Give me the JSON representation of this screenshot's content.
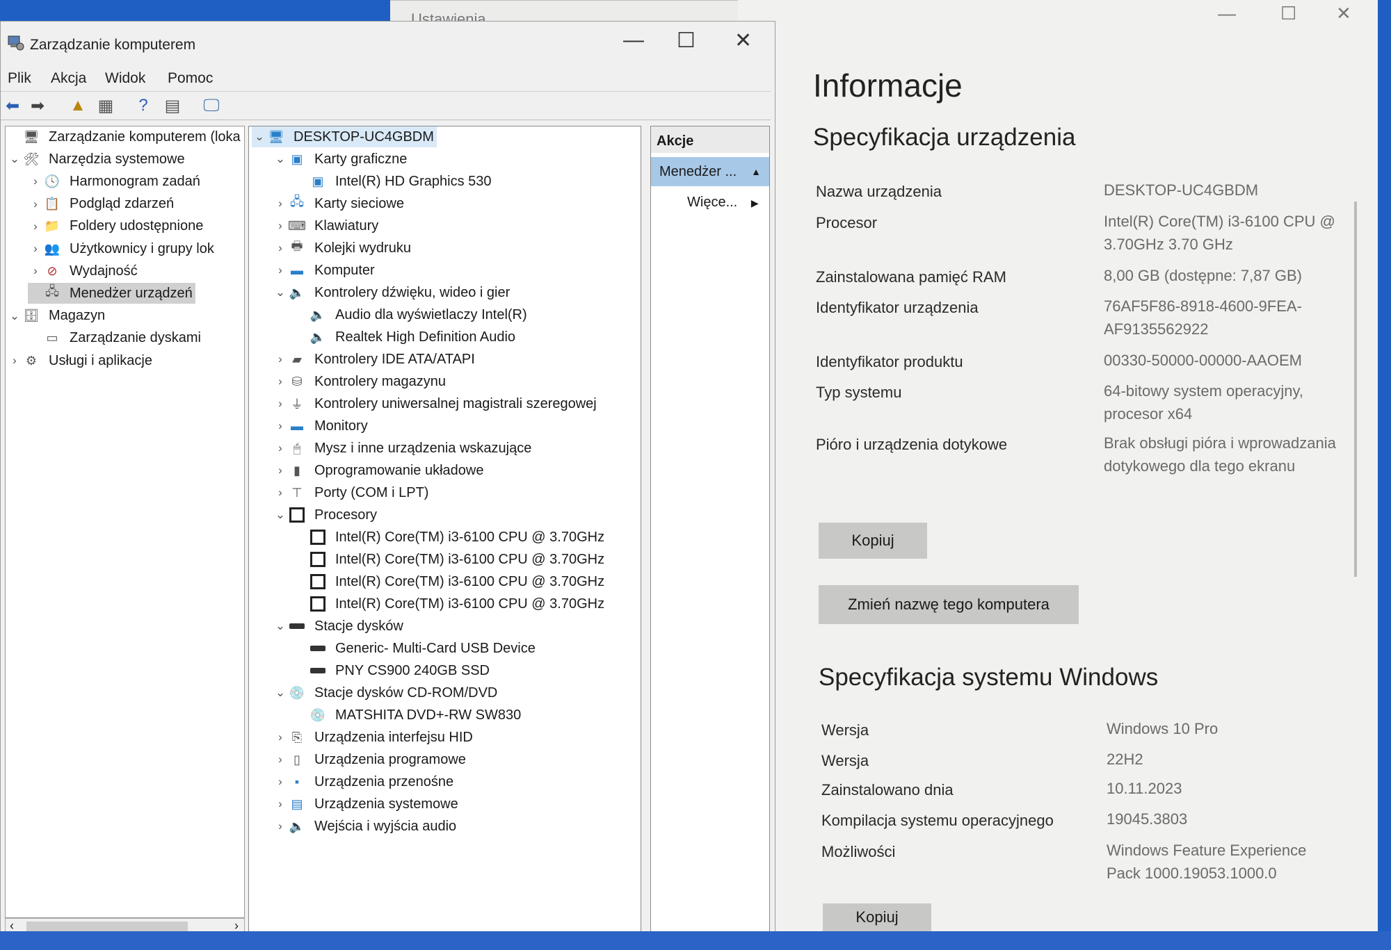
{
  "management": {
    "title": "Zarządzanie komputerem",
    "menu": [
      "Plik",
      "Akcja",
      "Widok",
      "Pomoc"
    ],
    "left_tree": [
      {
        "label": "Zarządzanie komputerem (loka",
        "level": 0,
        "chev": "",
        "icon": "computer-management-icon"
      },
      {
        "label": "Narzędzia systemowe",
        "level": 0,
        "chev": "v",
        "icon": "tools-icon"
      },
      {
        "label": "Harmonogram zadań",
        "level": 1,
        "chev": ">",
        "icon": "clock-icon"
      },
      {
        "label": "Podgląd zdarzeń",
        "level": 1,
        "chev": ">",
        "icon": "event-viewer-icon"
      },
      {
        "label": "Foldery udostępnione",
        "level": 1,
        "chev": ">",
        "icon": "shared-folder-icon"
      },
      {
        "label": "Użytkownicy i grupy lok",
        "level": 1,
        "chev": ">",
        "icon": "users-icon"
      },
      {
        "label": "Wydajność",
        "level": 1,
        "chev": ">",
        "icon": "performance-icon"
      },
      {
        "label": "Menedżer urządzeń",
        "level": 1,
        "chev": "",
        "icon": "device-manager-icon",
        "selected": true
      },
      {
        "label": "Magazyn",
        "level": 0,
        "chev": "v",
        "icon": "storage-icon"
      },
      {
        "label": "Zarządzanie dyskami",
        "level": 1,
        "chev": "",
        "icon": "disk-management-icon"
      },
      {
        "label": "Usługi i aplikacje",
        "level": 0,
        "chev": ">",
        "icon": "services-icon"
      }
    ],
    "device_tree": [
      {
        "label": "DESKTOP-UC4GBDM",
        "level": 0,
        "chev": "v",
        "icon": "desktop-icon",
        "selected": true
      },
      {
        "label": "Karty graficzne",
        "level": 1,
        "chev": "v",
        "icon": "display-adapter-icon"
      },
      {
        "label": "Intel(R) HD Graphics 530",
        "level": 2,
        "chev": "",
        "icon": "display-adapter-icon"
      },
      {
        "label": "Karty sieciowe",
        "level": 1,
        "chev": ">",
        "icon": "network-adapter-icon"
      },
      {
        "label": "Klawiatury",
        "level": 1,
        "chev": ">",
        "icon": "keyboard-icon"
      },
      {
        "label": "Kolejki wydruku",
        "level": 1,
        "chev": ">",
        "icon": "printer-icon"
      },
      {
        "label": "Komputer",
        "level": 1,
        "chev": ">",
        "icon": "monitor-icon"
      },
      {
        "label": "Kontrolery dźwięku, wideo i gier",
        "level": 1,
        "chev": "v",
        "icon": "speaker-icon"
      },
      {
        "label": "Audio dla wyświetlaczy Intel(R)",
        "level": 2,
        "chev": "",
        "icon": "speaker-icon"
      },
      {
        "label": "Realtek High Definition Audio",
        "level": 2,
        "chev": "",
        "icon": "speaker-icon"
      },
      {
        "label": "Kontrolery IDE ATA/ATAPI",
        "level": 1,
        "chev": ">",
        "icon": "ide-controller-icon"
      },
      {
        "label": "Kontrolery magazynu",
        "level": 1,
        "chev": ">",
        "icon": "storage-controller-icon"
      },
      {
        "label": "Kontrolery uniwersalnej magistrali szeregowej",
        "level": 1,
        "chev": ">",
        "icon": "usb-icon"
      },
      {
        "label": "Monitory",
        "level": 1,
        "chev": ">",
        "icon": "monitor-icon"
      },
      {
        "label": "Mysz i inne urządzenia wskazujące",
        "level": 1,
        "chev": ">",
        "icon": "mouse-icon"
      },
      {
        "label": "Oprogramowanie układowe",
        "level": 1,
        "chev": ">",
        "icon": "firmware-icon"
      },
      {
        "label": "Porty (COM i LPT)",
        "level": 1,
        "chev": ">",
        "icon": "port-icon"
      },
      {
        "label": "Procesory",
        "level": 1,
        "chev": "v",
        "icon": "cpu-icon"
      },
      {
        "label": "Intel(R) Core(TM) i3-6100 CPU @ 3.70GHz",
        "level": 2,
        "chev": "",
        "icon": "cpu-icon"
      },
      {
        "label": "Intel(R) Core(TM) i3-6100 CPU @ 3.70GHz",
        "level": 2,
        "chev": "",
        "icon": "cpu-icon"
      },
      {
        "label": "Intel(R) Core(TM) i3-6100 CPU @ 3.70GHz",
        "level": 2,
        "chev": "",
        "icon": "cpu-icon"
      },
      {
        "label": "Intel(R) Core(TM) i3-6100 CPU @ 3.70GHz",
        "level": 2,
        "chev": "",
        "icon": "cpu-icon"
      },
      {
        "label": "Stacje dysków",
        "level": 1,
        "chev": "v",
        "icon": "disk-drive-icon"
      },
      {
        "label": "Generic- Multi-Card USB Device",
        "level": 2,
        "chev": "",
        "icon": "disk-drive-icon"
      },
      {
        "label": "PNY CS900 240GB SSD",
        "level": 2,
        "chev": "",
        "icon": "disk-drive-icon"
      },
      {
        "label": "Stacje dysków CD-ROM/DVD",
        "level": 1,
        "chev": "v",
        "icon": "cdrom-icon"
      },
      {
        "label": "MATSHITA DVD+-RW SW830",
        "level": 2,
        "chev": "",
        "icon": "cdrom-icon"
      },
      {
        "label": "Urządzenia interfejsu HID",
        "level": 1,
        "chev": ">",
        "icon": "hid-icon"
      },
      {
        "label": "Urządzenia programowe",
        "level": 1,
        "chev": ">",
        "icon": "software-device-icon"
      },
      {
        "label": "Urządzenia przenośne",
        "level": 1,
        "chev": ">",
        "icon": "portable-device-icon"
      },
      {
        "label": "Urządzenia systemowe",
        "level": 1,
        "chev": ">",
        "icon": "system-device-icon"
      },
      {
        "label": "Wejścia i wyjścia audio",
        "level": 1,
        "chev": ">",
        "icon": "speaker-icon"
      }
    ],
    "actions": {
      "title": "Akcje",
      "selected": "Menedżer ...",
      "more": "Więce..."
    }
  },
  "settings": {
    "back_title": "Ustawienia",
    "title": "Informacje",
    "device_spec_title": "Specyfikacja urządzenia",
    "device_spec": [
      {
        "label": "Nazwa urządzenia",
        "value": "DESKTOP-UC4GBDM"
      },
      {
        "label": "Procesor",
        "value": "Intel(R) Core(TM) i3-6100 CPU @ 3.70GHz   3.70 GHz"
      },
      {
        "label": "Zainstalowana pamięć RAM",
        "value": "8,00 GB (dostępne: 7,87 GB)"
      },
      {
        "label": "Identyfikator urządzenia",
        "value": "76AF5F86-8918-4600-9FEA-AF9135562922"
      },
      {
        "label": "Identyfikator produktu",
        "value": "00330-50000-00000-AAOEM"
      },
      {
        "label": "Typ systemu",
        "value": "64-bitowy system operacyjny, procesor x64"
      },
      {
        "label": "Pióro i urządzenia dotykowe",
        "value": "Brak obsługi pióra i wprowadzania dotykowego dla tego ekranu"
      }
    ],
    "copy_button": "Kopiuj",
    "rename_button": "Zmień nazwę tego komputera",
    "windows_spec_title": "Specyfikacja systemu Windows",
    "windows_spec": [
      {
        "label": "Wersja",
        "value": "Windows 10 Pro"
      },
      {
        "label": "Wersja",
        "value": "22H2"
      },
      {
        "label": "Zainstalowano dnia",
        "value": "10.11.2023"
      },
      {
        "label": "Kompilacja systemu operacyjnego",
        "value": "19045.3803"
      },
      {
        "label": "Możliwości",
        "value": "Windows Feature Experience Pack 1000.19053.1000.0"
      }
    ],
    "copy_button2": "Kopiuj"
  }
}
